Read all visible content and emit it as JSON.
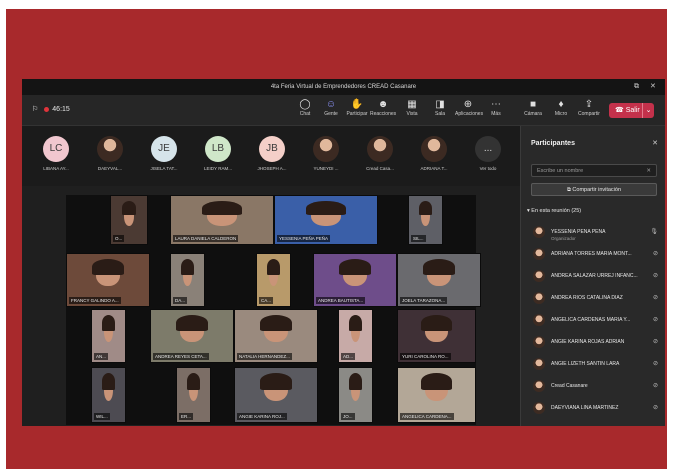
{
  "window": {
    "title": "4ta Feria Virtual de Emprendedores CREAD Casanare"
  },
  "toolbar": {
    "timer": "46:15",
    "buttons": [
      {
        "label": "Chat",
        "icon": "chat-icon"
      },
      {
        "label": "Gente",
        "icon": "people-icon"
      },
      {
        "label": "Participar",
        "icon": "raise-hand-icon"
      },
      {
        "label": "Reacciones",
        "icon": "emoji-icon"
      },
      {
        "label": "Vista",
        "icon": "grid-view-icon"
      },
      {
        "label": "Sala",
        "icon": "rooms-icon"
      },
      {
        "label": "Aplicaciones",
        "icon": "apps-icon"
      },
      {
        "label": "Más",
        "icon": "more-icon"
      },
      {
        "label": "Cámara",
        "icon": "camera-icon"
      },
      {
        "label": "Micro",
        "icon": "mic-icon"
      },
      {
        "label": "Compartir",
        "icon": "share-icon"
      }
    ],
    "leave_label": "Salir",
    "leave_color": "#c4314b"
  },
  "avatars": [
    {
      "initials": "LC",
      "name": "LIBANA AY...",
      "color": "#f1c7cf",
      "photo": false
    },
    {
      "initials": "",
      "name": "DAEYVAL...",
      "color": "",
      "photo": true
    },
    {
      "initials": "JE",
      "name": "JISELA TAT...",
      "color": "#d6e4ea",
      "photo": false
    },
    {
      "initials": "LB",
      "name": "LEIDY RAM...",
      "color": "#cfe7c9",
      "photo": false
    },
    {
      "initials": "JB",
      "name": "JHOSEPH A...",
      "color": "#f4cfc8",
      "photo": false
    },
    {
      "initials": "",
      "name": "YUNEYDI ...",
      "color": "",
      "photo": true
    },
    {
      "initials": "",
      "name": "Cread Casa...",
      "color": "",
      "photo": true
    },
    {
      "initials": "",
      "name": "ADRIANA T...",
      "color": "",
      "photo": true
    },
    {
      "initials": "...",
      "name": "Ver todo",
      "color": "#333333",
      "photo": false
    }
  ],
  "tiles": [
    {
      "name": "O...",
      "bg": "#4b3a33"
    },
    {
      "name": "LAURA DANIELA CALDERON",
      "bg": "#8a7766"
    },
    {
      "name": "YESSENIA PEÑA PEÑA",
      "bg": "#3a5fa8"
    },
    {
      "name": "SIL...",
      "bg": "#5e5f66"
    },
    {
      "name": "FRANCY GALINDO A...",
      "bg": "#6d4a3a"
    },
    {
      "name": "DA...",
      "bg": "#8a8178"
    },
    {
      "name": "CA...",
      "bg": "#b89a6a"
    },
    {
      "name": "ANDREA BAUTISTA...",
      "bg": "#6e4d8a"
    },
    {
      "name": "JOELA TARAZONA...",
      "bg": "#6a6a6e"
    },
    {
      "name": "AN...",
      "bg": "#a08b87"
    },
    {
      "name": "ANDREA REYES CETA...",
      "bg": "#7d7b6a"
    },
    {
      "name": "NATALIA HERNANDEZ...",
      "bg": "#9a8a7e"
    },
    {
      "name": "AD...",
      "bg": "#c7aaa7"
    },
    {
      "name": "YURI CAROLINA RO...",
      "bg": "#3f3036"
    },
    {
      "name": "WIL...",
      "bg": "#4d4b52"
    },
    {
      "name": "ER...",
      "bg": "#7c6e66"
    },
    {
      "name": "ANGIE KARINA ROJ...",
      "bg": "#5a5a60"
    },
    {
      "name": "JO...",
      "bg": "#8b8a86"
    },
    {
      "name": "ANGELICA CARDENA...",
      "bg": "#b3a797"
    }
  ],
  "panel": {
    "title": "Participantes",
    "search_placeholder": "Escribe un nombre",
    "share_label": "Compartir invitación",
    "section_label": "En esta reunión (25)",
    "participants": [
      {
        "name": "YESSENIA PEÑA PEÑA",
        "role": "Organizador"
      },
      {
        "name": "ADRIANA TORRES MARIA MONT...",
        "role": ""
      },
      {
        "name": "ANDREA SALAZAR URREJ INFANC...",
        "role": ""
      },
      {
        "name": "ANDREA RIOS CATALINA DIAZ",
        "role": ""
      },
      {
        "name": "ANGELICA CARDENAS MARIA Y...",
        "role": ""
      },
      {
        "name": "ANGIE KARINA ROJAS ADRIAN",
        "role": ""
      },
      {
        "name": "ANGIE LIZETH SANTIN LARA",
        "role": ""
      },
      {
        "name": "Cread Casanare",
        "role": ""
      },
      {
        "name": "DAEYVIANA LINA MARTINEZ",
        "role": ""
      }
    ]
  }
}
